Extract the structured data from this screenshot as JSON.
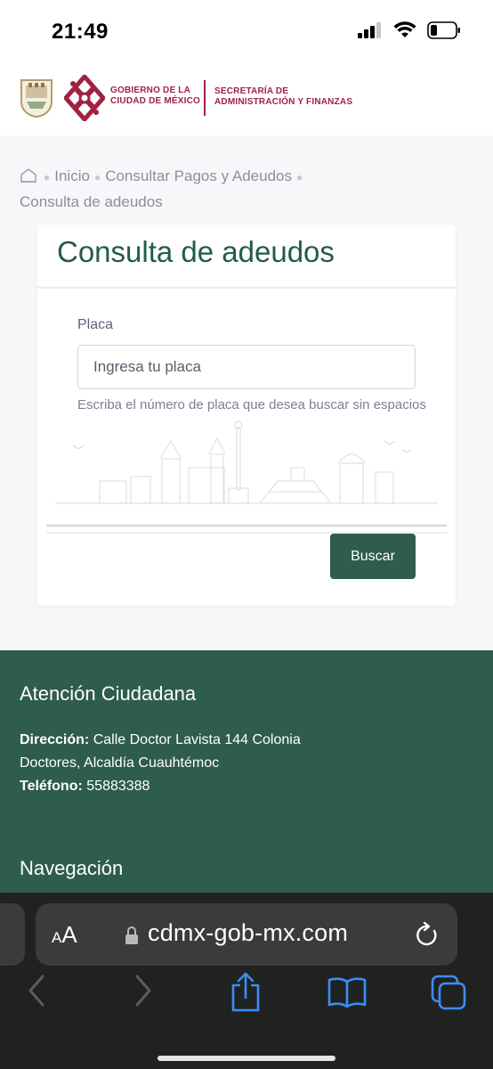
{
  "status_bar": {
    "time": "21:49",
    "battery_level": 0.2
  },
  "header": {
    "gov_line1": "GOBIERNO DE LA",
    "gov_line2": "CIUDAD DE MÉXICO",
    "sec_line1": "SECRETARÍA DE",
    "sec_line2": "ADMINISTRACIÓN Y FINANZAS",
    "brand_color": "#9f2241"
  },
  "breadcrumb": {
    "home_icon": "home-icon",
    "items": [
      "Inicio",
      "Consultar Pagos y Adeudos",
      "Consulta de adeudos"
    ]
  },
  "card": {
    "title": "Consulta de adeudos",
    "field_label": "Placa",
    "input_placeholder": "Ingresa tu placa",
    "input_value": "",
    "help_text": "Escriba el número de placa que desea buscar sin espacios",
    "search_button": "Buscar",
    "accent_color": "#235b4e"
  },
  "footer": {
    "title": "Atención Ciudadana",
    "address_label": "Dirección:",
    "address_value": "Calle Doctor Lavista 144 Colonia Doctores, Alcaldía Cuauhtémoc",
    "phone_label": "Teléfono:",
    "phone_value": "55883388",
    "nav_title": "Navegación",
    "bg_color": "#2e5c4d"
  },
  "browser": {
    "aa_small": "A",
    "aa_large": "A",
    "url": "cdmx-gob-mx.com",
    "toolbar": [
      "back-icon",
      "forward-icon",
      "share-icon",
      "bookmarks-icon",
      "tabs-icon"
    ]
  }
}
